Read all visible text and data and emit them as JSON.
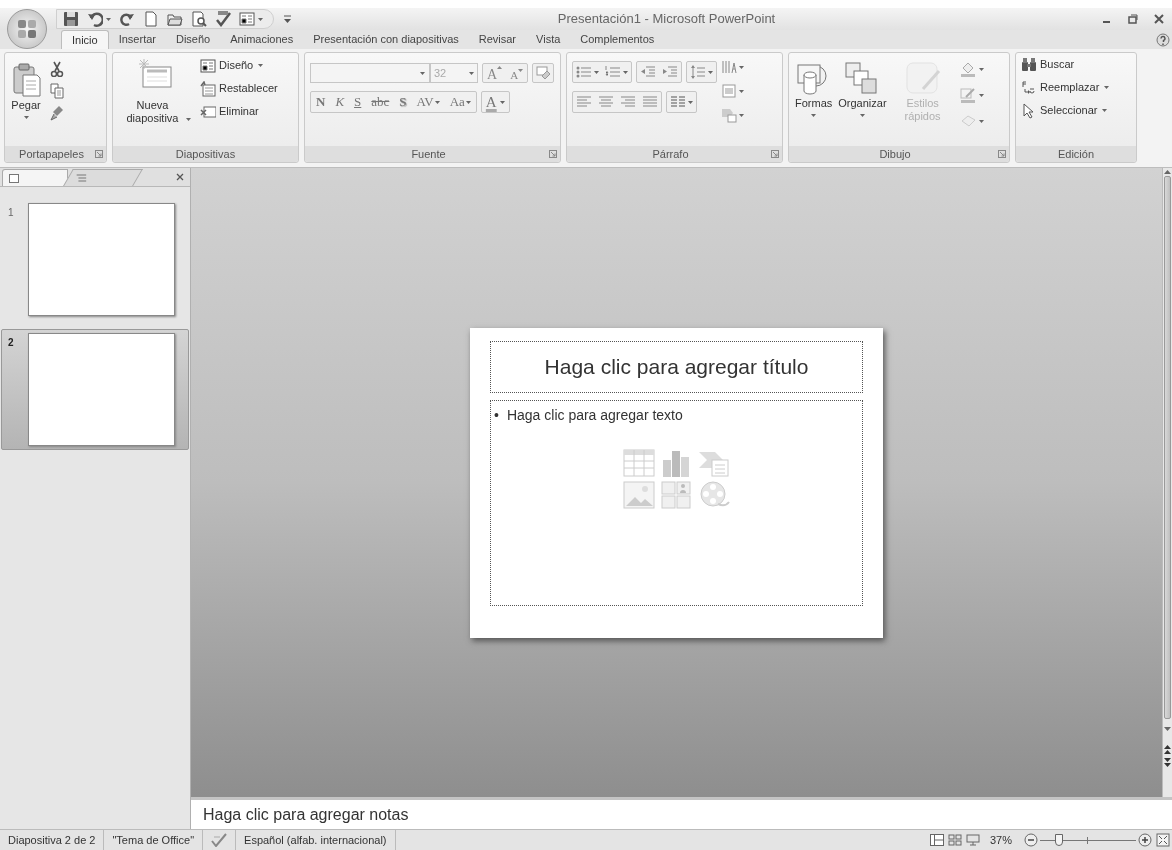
{
  "window": {
    "title": "Presentación1 - Microsoft PowerPoint"
  },
  "tabs": [
    {
      "label": "Inicio",
      "selected": true
    },
    {
      "label": "Insertar",
      "selected": false
    },
    {
      "label": "Diseño",
      "selected": false
    },
    {
      "label": "Animaciones",
      "selected": false
    },
    {
      "label": "Presentación con diapositivas",
      "selected": false
    },
    {
      "label": "Revisar",
      "selected": false
    },
    {
      "label": "Vista",
      "selected": false
    },
    {
      "label": "Complementos",
      "selected": false
    }
  ],
  "ribbon": {
    "groups": [
      {
        "kind": "clipboard",
        "label": "Portapapeles",
        "launcher": true,
        "big_button": "Pegar"
      },
      {
        "kind": "slides",
        "label": "Diapositivas",
        "launcher": false,
        "big_button": "Nueva diapositiva",
        "buttons": [
          {
            "label": "Diseño",
            "dropdown": true
          },
          {
            "label": "Restablecer",
            "dropdown": false
          },
          {
            "label": "Eliminar",
            "dropdown": false
          }
        ]
      },
      {
        "kind": "font",
        "label": "Fuente",
        "launcher": true,
        "font_size": "32",
        "size_buttons": [
          {
            "kind": "grow",
            "label": "A"
          },
          {
            "kind": "shrink",
            "label": "A"
          }
        ],
        "format_buttons": [
          {
            "kind": "bold",
            "label": "N"
          },
          {
            "kind": "italic",
            "label": "K"
          },
          {
            "kind": "underline",
            "label": "S"
          },
          {
            "kind": "strike",
            "label": "abc"
          },
          {
            "kind": "shadow",
            "label": "S"
          },
          {
            "kind": "spacing",
            "label": "AV"
          },
          {
            "kind": "case",
            "label": "Aa"
          }
        ],
        "color_button": "A"
      },
      {
        "kind": "paragraph",
        "label": "Párrafo",
        "launcher": true
      },
      {
        "kind": "drawing",
        "label": "Dibujo",
        "launcher": true,
        "buttons": [
          {
            "label": "Formas",
            "disabled": false
          },
          {
            "label": "Organizar",
            "disabled": false
          },
          {
            "label": "Estilos rápidos",
            "disabled": true
          }
        ]
      },
      {
        "kind": "editing",
        "label": "Edición",
        "launcher": false,
        "buttons": [
          {
            "label": "Buscar",
            "dropdown": false
          },
          {
            "label": "Reemplazar",
            "dropdown": true
          },
          {
            "label": "Seleccionar",
            "dropdown": true
          }
        ]
      }
    ]
  },
  "slides_panel": {
    "thumbnails": [
      {
        "number": "1",
        "selected": false
      },
      {
        "number": "2",
        "selected": true
      }
    ]
  },
  "slide": {
    "title_placeholder": "Haga clic para agregar título",
    "bullet": "•",
    "body_placeholder": "Haga clic para agregar texto"
  },
  "notes": {
    "placeholder": "Haga clic para agregar notas"
  },
  "status_bar": {
    "items": [
      {
        "kind": "text",
        "label": "Diapositiva 2 de 2"
      },
      {
        "kind": "text",
        "label": "\"Tema de Office\""
      },
      {
        "kind": "language",
        "label": "Español (alfab. internacional)"
      }
    ],
    "zoom": {
      "reading": "37%",
      "level": 0.2
    }
  }
}
